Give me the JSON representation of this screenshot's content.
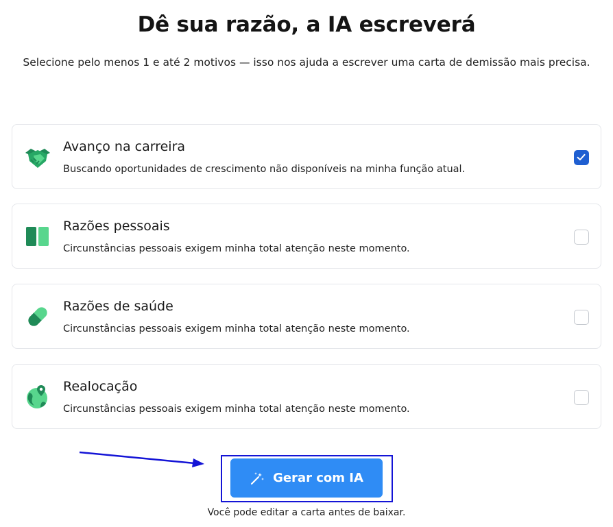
{
  "header": {
    "title": "Dê sua razão, a IA escreverá",
    "subtitle": "Selecione pelo menos 1 e até 2 motivos — isso nos ajuda a escrever uma carta de demissão mais precisa."
  },
  "reasons": [
    {
      "icon": "handshake-icon",
      "title": "Avanço na carreira",
      "description": "Buscando oportunidades de crescimento não disponíveis na minha função atual.",
      "checked": true
    },
    {
      "icon": "columns-icon",
      "title": "Razões pessoais",
      "description": "Circunstâncias pessoais exigem minha total atenção neste momento.",
      "checked": false
    },
    {
      "icon": "pill-icon",
      "title": "Razões de saúde",
      "description": "Circunstâncias pessoais exigem minha total atenção neste momento.",
      "checked": false
    },
    {
      "icon": "globe-pin-icon",
      "title": "Realocação",
      "description": "Circunstâncias pessoais exigem minha total atenção neste momento.",
      "checked": false
    }
  ],
  "action": {
    "button_label": "Gerar com IA",
    "button_icon": "magic-wand-icon",
    "note": "Você pode editar a carta antes de baixar."
  },
  "colors": {
    "accent": "#2f8cf5",
    "checkbox_checked": "#1f5fd1",
    "icon_dark_green": "#1f8a57",
    "icon_light_green": "#58d68d",
    "annotation_blue": "#1414d6"
  }
}
